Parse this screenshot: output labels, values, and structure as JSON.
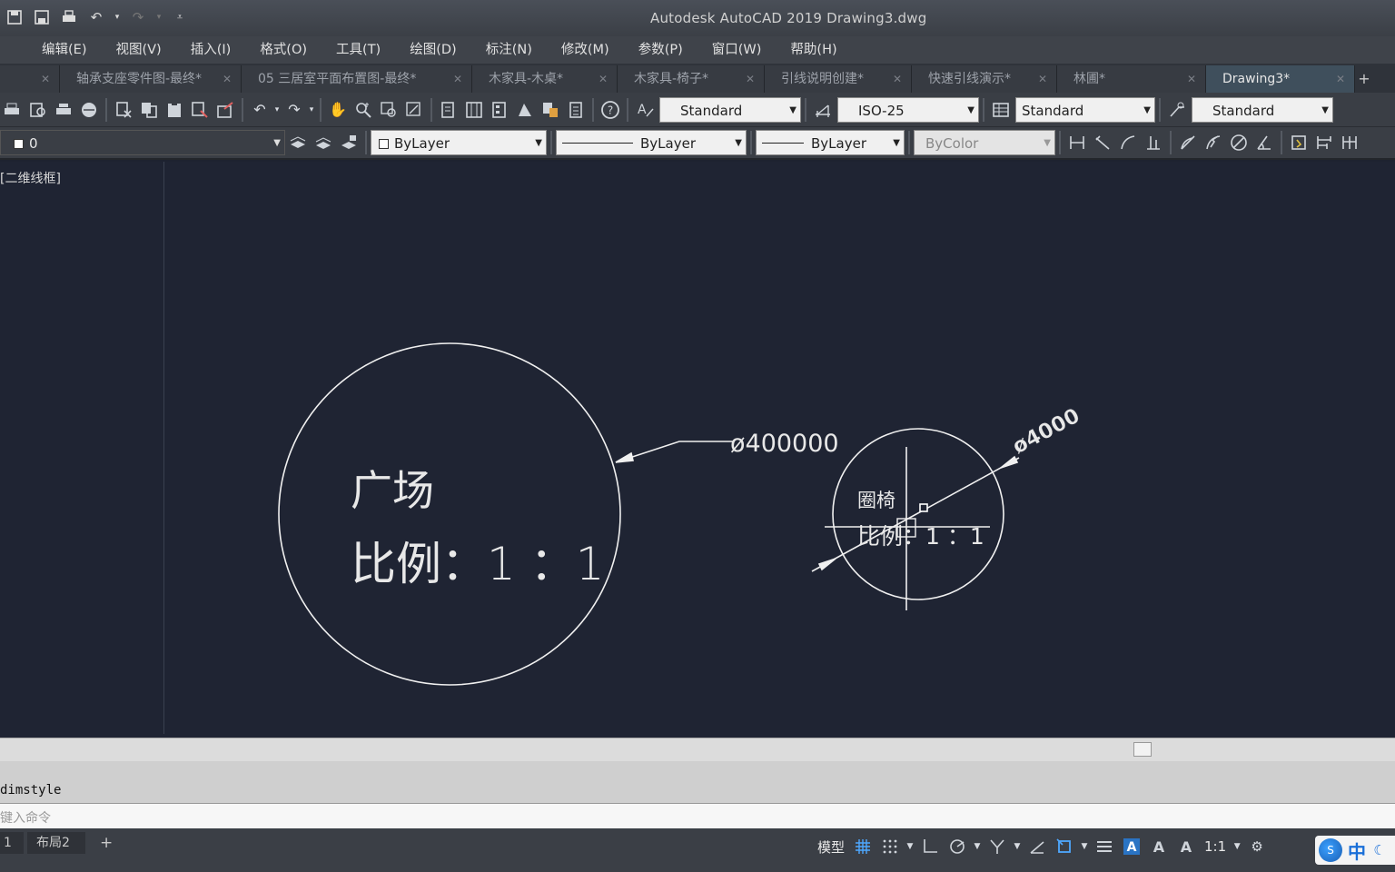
{
  "window": {
    "title": "Autodesk AutoCAD 2019    Drawing3.dwg"
  },
  "menus": [
    "编辑(E)",
    "视图(V)",
    "插入(I)",
    "格式(O)",
    "工具(T)",
    "绘图(D)",
    "标注(N)",
    "修改(M)",
    "参数(P)",
    "窗口(W)",
    "帮助(H)"
  ],
  "tabs": [
    {
      "label": "轴承支座零件图-最终*",
      "active": false
    },
    {
      "label": "05 三居室平面布置图-最终*",
      "active": false
    },
    {
      "label": "木家具-木桌*",
      "active": false
    },
    {
      "label": "木家具-椅子*",
      "active": false
    },
    {
      "label": "引线说明创建*",
      "active": false
    },
    {
      "label": "快速引线演示*",
      "active": false
    },
    {
      "label": "林圃*",
      "active": false
    },
    {
      "label": "Drawing3*",
      "active": true
    }
  ],
  "toolbar_styles": {
    "text_style": "Standard",
    "dim_style": "ISO-25",
    "table_style": "Standard",
    "mleader_style": "Standard"
  },
  "toolbar_layers": {
    "layer": "0",
    "color": "ByLayer",
    "linetype": "ByLayer",
    "lineweight": "ByLayer",
    "plotstyle": "ByColor"
  },
  "viewport": {
    "label": "[二维线框]"
  },
  "drawing": {
    "circle1_text1": "广场",
    "circle1_text2": "比例：1 ：1",
    "circle1_dim": "ø400000",
    "circle2_text1": "圈椅",
    "circle2_text2": "比例：1 ：1",
    "circle2_dim": "ø4000"
  },
  "command": {
    "history": "dimstyle",
    "prompt": "键入命令"
  },
  "layout_tabs": [
    "1",
    "布局2",
    "+"
  ],
  "status": {
    "model": "模型",
    "scale": "1:1",
    "ime_text": "中"
  },
  "colors": {
    "canvas": "#1f2433",
    "ink": "#f0f0f0",
    "accent": "#4ea8ff"
  }
}
